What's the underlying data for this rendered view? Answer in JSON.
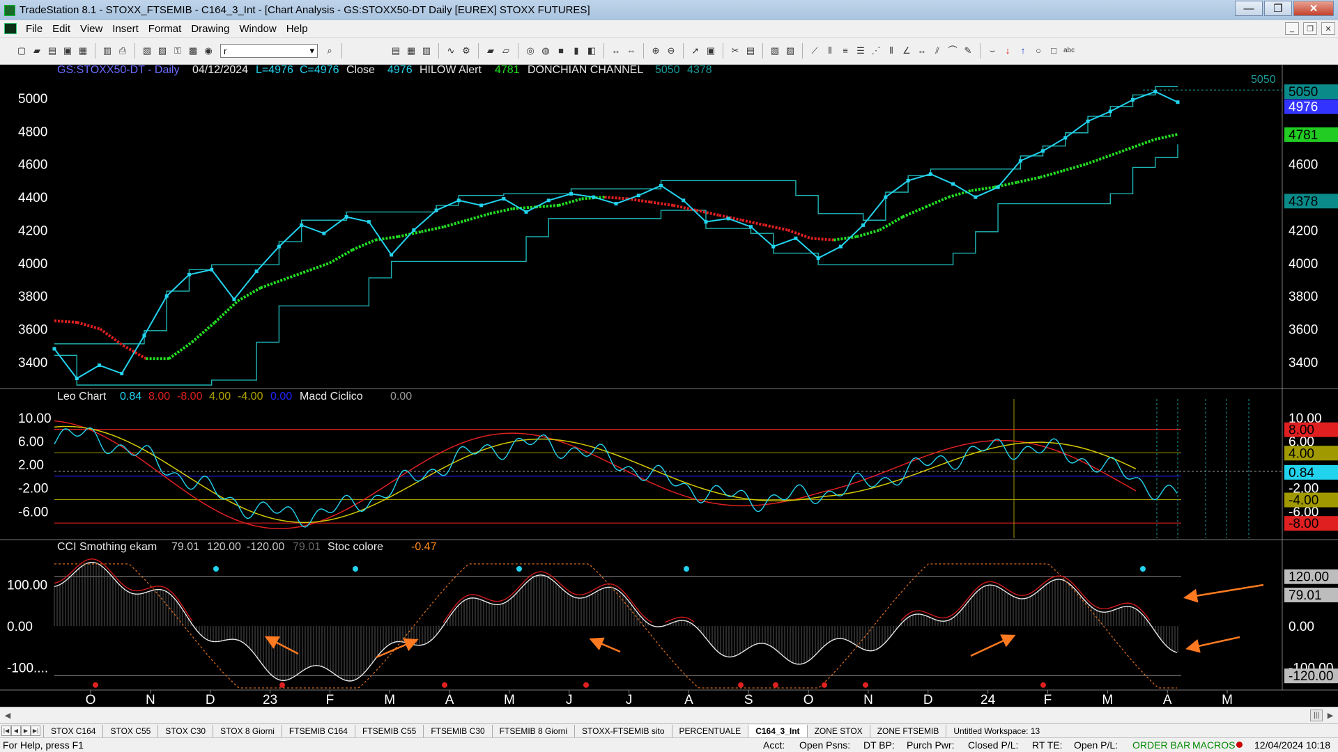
{
  "window": {
    "title": "TradeStation 8.1 - STOXX_FTSEMIB - C164_3_Int - [Chart Analysis - GS:STOXX50-DT  Daily  [EUREX] STOXX FUTURES]",
    "minimize": "—",
    "maximize": "❐",
    "close": "✕"
  },
  "menu": [
    "File",
    "Edit",
    "View",
    "Insert",
    "Format",
    "Drawing",
    "Window",
    "Help"
  ],
  "mdi_buttons": [
    "_",
    "❐",
    "✕"
  ],
  "toolbar": {
    "symbol_value": "r",
    "symbol_dropdown": "▾"
  },
  "price_panel": {
    "symbol": "GS:STOXX50-DT - Daily",
    "date": "04/12/2024",
    "low": "L=4976",
    "close_label": "C=4976",
    "close_word": "Close",
    "close_value": "4976",
    "hilow_label": "HILOW Alert",
    "hilow_value": "4781",
    "donchian_label": "DONCHIAN CHANNEL",
    "donchian_upper": "5050",
    "donchian_lower": "4378",
    "corner_tag": "5050",
    "axis_ticks": [
      "5000",
      "4800",
      "4600",
      "4400",
      "4200",
      "4000",
      "3800",
      "3600",
      "3400"
    ],
    "right_labels": [
      "4600",
      "4200",
      "4000",
      "3800",
      "3600",
      "3400"
    ],
    "badges": {
      "upper": "5050",
      "close": "4976",
      "hilow": "4781",
      "lower": "4378"
    }
  },
  "osc_panel": {
    "title": "Leo Chart",
    "v1": "0.84",
    "v2": "8.00",
    "v3": "-8.00",
    "v4": "4.00",
    "v5": "-4.00",
    "v6": "0.00",
    "indicator2": "Macd Ciclico",
    "v7": "0.00",
    "axis_ticks": [
      "10.00",
      "6.00",
      "2.00",
      "-2.00",
      "-6.00"
    ],
    "right_labels": [
      "10.00",
      "6.00",
      "-2.00",
      "-6.00"
    ],
    "badges": {
      "upper": "8.00",
      "mid_upper": "4.00",
      "value": "0.84",
      "mid_lower": "-4.00",
      "lower": "-8.00"
    }
  },
  "cci_panel": {
    "title": "CCI Smothing ekam",
    "v1": "79.01",
    "v2": "120.00",
    "v3": "-120.00",
    "v4": "79.01",
    "indicator2": "Stoc colore",
    "v5": "-0.47",
    "axis_ticks": [
      "100.00",
      "0.00",
      "-100...."
    ],
    "right_labels": [
      "0.00",
      "-100.00"
    ],
    "badges": {
      "upper": "120.00",
      "value": "79.01",
      "lower": "-120.00"
    }
  },
  "x_axis": [
    "O",
    "N",
    "D",
    "23",
    "F",
    "M",
    "A",
    "M",
    "J",
    "J",
    "A",
    "S",
    "O",
    "N",
    "D",
    "24",
    "F",
    "M",
    "A",
    "M"
  ],
  "tabs": [
    "STOX C164",
    "STOX C55",
    "STOX  C30",
    "STOX  8 Giorni",
    "FTSEMIB C164",
    "FTSEMIB C55",
    "FTSEMIB C30",
    "FTSEMIB  8 Giorni",
    "STOXX-FTSEMIB sito",
    "PERCENTUALE",
    "C164_3_Int",
    "ZONE STOX",
    "ZONE FTSEMIB",
    "Untitled Workspace:  13"
  ],
  "active_tab": "C164_3_Int",
  "status": {
    "help": "For Help, press F1",
    "acct": "Acct:",
    "open_psns": "Open Psns:",
    "dt_bp": "DT BP:",
    "purch_pwr": "Purch Pwr:",
    "closed_pl": "Closed P/L:",
    "rt_te": "RT TE:",
    "open_pl": "Open P/L:",
    "order_bar": "ORDER BAR",
    "macros": "MACROS",
    "datetime": "12/04/2024 10:18"
  },
  "colors": {
    "price_bars": "#22d3ee",
    "donchian": "#1fb6b6",
    "hilow_up": "#22dd22",
    "hilow_down": "#e02020",
    "badge_upper": "#0b8a8a",
    "badge_close": "#3333ff",
    "badge_hilow": "#22cc22",
    "osc_red": "#e02020",
    "osc_yellow": "#d4c800",
    "osc_cyan": "#22d3ee",
    "arrow": "#ff7a20"
  },
  "chart_data": {
    "type": "line",
    "series": [
      {
        "name": "Close",
        "values": [
          3480,
          3300,
          3380,
          3330,
          3560,
          3800,
          3930,
          3960,
          3780,
          3950,
          4100,
          4230,
          4180,
          4280,
          4250,
          4050,
          4200,
          4320,
          4380,
          4350,
          4390,
          4310,
          4380,
          4420,
          4400,
          4360,
          4410,
          4470,
          4380,
          4250,
          4270,
          4220,
          4100,
          4150,
          4030,
          4100,
          4230,
          4400,
          4500,
          4540,
          4480,
          4400,
          4460,
          4620,
          4680,
          4760,
          4860,
          4920,
          4990,
          5040,
          4976
        ]
      },
      {
        "name": "HILOW Alert",
        "values": [
          3650,
          3640,
          3600,
          3500,
          3420,
          3420,
          3520,
          3640,
          3770,
          3850,
          3900,
          3950,
          4000,
          4080,
          4140,
          4160,
          4190,
          4220,
          4260,
          4300,
          4330,
          4340,
          4350,
          4390,
          4400,
          4390,
          4370,
          4350,
          4320,
          4290,
          4260,
          4230,
          4200,
          4150,
          4140,
          4160,
          4200,
          4280,
          4340,
          4400,
          4440,
          4460,
          4490,
          4520,
          4560,
          4600,
          4650,
          4700,
          4750,
          4781
        ]
      }
    ],
    "ylim": [
      3260,
      5110
    ]
  }
}
